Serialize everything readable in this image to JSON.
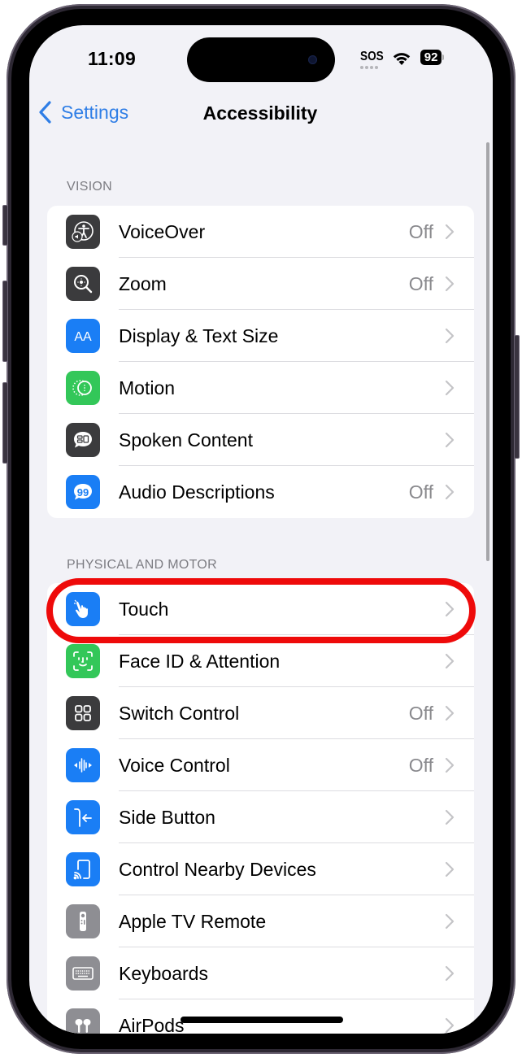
{
  "status_bar": {
    "time": "11:09",
    "carrier_text": "SOS",
    "wifi_icon": "wifi-icon",
    "battery_level": "92"
  },
  "nav": {
    "back_label": "Settings",
    "back_icon": "chevron-left-icon",
    "title": "Accessibility"
  },
  "sections": [
    {
      "header": "VISION",
      "items": [
        {
          "label": "VoiceOver",
          "value": "Off",
          "icon": "voiceover-icon",
          "icon_color": "#3b3b3d"
        },
        {
          "label": "Zoom",
          "value": "Off",
          "icon": "zoom-icon",
          "icon_color": "#3b3b3d"
        },
        {
          "label": "Display & Text Size",
          "value": "",
          "icon": "text-size-icon",
          "icon_color": "#1a7ef5"
        },
        {
          "label": "Motion",
          "value": "",
          "icon": "motion-icon",
          "icon_color": "#33c759"
        },
        {
          "label": "Spoken Content",
          "value": "",
          "icon": "spoken-content-icon",
          "icon_color": "#3b3b3d"
        },
        {
          "label": "Audio Descriptions",
          "value": "Off",
          "icon": "audio-descriptions-icon",
          "icon_color": "#1a7ef5"
        }
      ]
    },
    {
      "header": "PHYSICAL AND MOTOR",
      "items": [
        {
          "label": "Touch",
          "value": "",
          "icon": "touch-hand-icon",
          "icon_color": "#1a7ef5"
        },
        {
          "label": "Face ID & Attention",
          "value": "",
          "icon": "face-id-icon",
          "icon_color": "#33c759"
        },
        {
          "label": "Switch Control",
          "value": "Off",
          "icon": "switch-control-icon",
          "icon_color": "#3b3b3d"
        },
        {
          "label": "Voice Control",
          "value": "Off",
          "icon": "voice-control-icon",
          "icon_color": "#1a7ef5"
        },
        {
          "label": "Side Button",
          "value": "",
          "icon": "side-button-icon",
          "icon_color": "#1a7ef5"
        },
        {
          "label": "Control Nearby Devices",
          "value": "",
          "icon": "nearby-devices-icon",
          "icon_color": "#1a7ef5"
        },
        {
          "label": "Apple TV Remote",
          "value": "",
          "icon": "tv-remote-icon",
          "icon_color": "#8e8e93"
        },
        {
          "label": "Keyboards",
          "value": "",
          "icon": "keyboard-icon",
          "icon_color": "#8e8e93"
        },
        {
          "label": "AirPods",
          "value": "",
          "icon": "airpods-icon",
          "icon_color": "#8e8e93"
        }
      ]
    }
  ],
  "annotation": {
    "highlighted_item": "Touch",
    "highlight_color": "#ee0a0a"
  }
}
